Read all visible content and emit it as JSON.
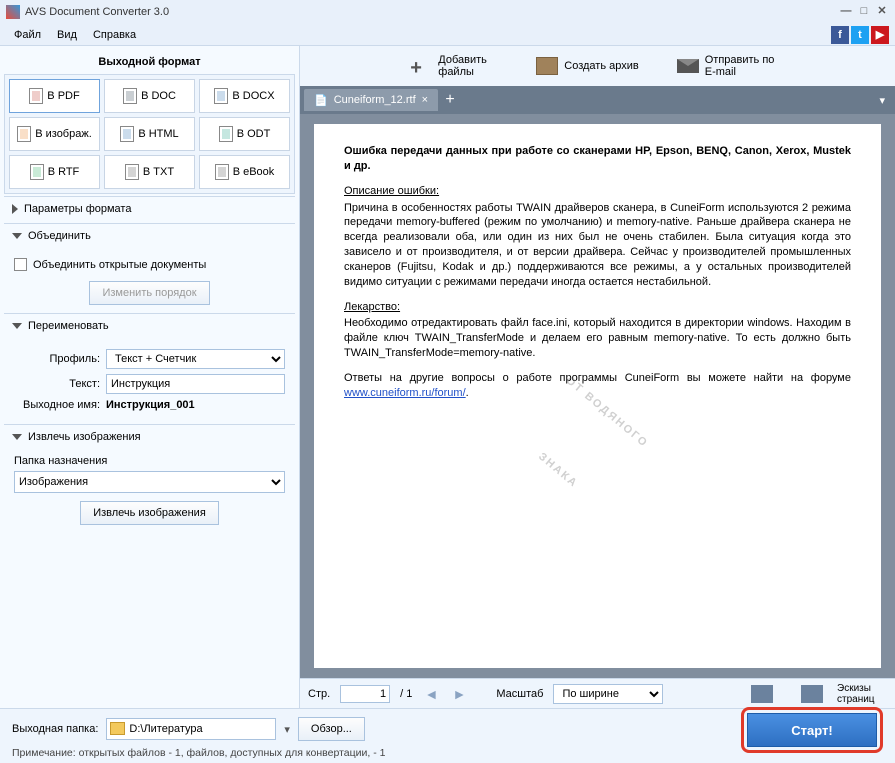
{
  "window": {
    "title": "AVS Document Converter 3.0"
  },
  "menu": {
    "file": "Файл",
    "view": "Вид",
    "help": "Справка"
  },
  "left": {
    "title": "Выходной формат",
    "formats": {
      "pdf": "В PDF",
      "doc": "В DOC",
      "docx": "В DOCX",
      "image": "В изображ.",
      "html": "В HTML",
      "odt": "В ODT",
      "rtf": "В RTF",
      "txt": "В TXT",
      "ebook": "В eBook"
    },
    "params_hdr": "Параметры формата",
    "merge_hdr": "Объединить",
    "merge_chk": "Объединить открытые документы",
    "merge_btn": "Изменить порядок",
    "rename_hdr": "Переименовать",
    "profile_lbl": "Профиль:",
    "profile_val": "Текст + Счетчик",
    "text_lbl": "Текст:",
    "text_val": "Инструкция",
    "outname_lbl": "Выходное имя:",
    "outname_val": "Инструкция_001",
    "extract_hdr": "Извлечь изображения",
    "dest_lbl": "Папка назначения",
    "dest_val": "Изображения",
    "extract_btn": "Извлечь изображения"
  },
  "top_actions": {
    "add": "Добавить файлы",
    "archive": "Создать архив",
    "email": "Отправить по E-mail"
  },
  "tab": {
    "name": "Cuneiform_12.rtf"
  },
  "doc": {
    "h": "Ошибка передачи данных при работе со сканерами HP, Epson, BENQ, Canon, Xerox, Mustek и др.",
    "s1": "Описание ошибки:",
    "p1": "Причина в особенностях работы TWAIN драйверов сканера, в CuneiForm используются 2 режима передачи memory-buffered (режим по умолчанию) и memory-native. Раньше драйвера сканера не всегда реализовали оба, или один из них был не очень стабилен. Была ситуация когда это зависело и от производителя, и от версии драйвера. Сейчас у производителей промышленных сканеров (Fujitsu, Kodak и др.) поддерживаются все режимы, а у остальных производителей видимо ситуации с режимами передачи иногда остается нестабильной.",
    "s2": "Лекарство:",
    "p2": "Необходимо отредактировать файл face.ini, который находится в директории windows. Находим в файле ключ TWAIN_TransferMode и делаем его равным memory-native. То есть должно быть TWAIN_TransferMode=memory-native.",
    "p3": "Ответы на другие вопросы о работе программы CuneiForm вы можете найти на форуме ",
    "link": "www.cuneiform.ru/forum/",
    "wm1": "ОТ ВОДЯНОГО",
    "wm2": "ЗНАКА"
  },
  "statusbar": {
    "page_lbl": "Стр.",
    "page_cur": "1",
    "page_tot": "/ 1",
    "zoom_lbl": "Масштаб",
    "zoom_val": "По ширине",
    "thumbs": "Эскизы страниц"
  },
  "bottom": {
    "out_lbl": "Выходная папка:",
    "out_val": "D:\\Литература",
    "browse": "Обзор...",
    "start": "Старт!",
    "note": "Примечание: открытых файлов - 1, файлов, доступных для конвертации, - 1"
  }
}
